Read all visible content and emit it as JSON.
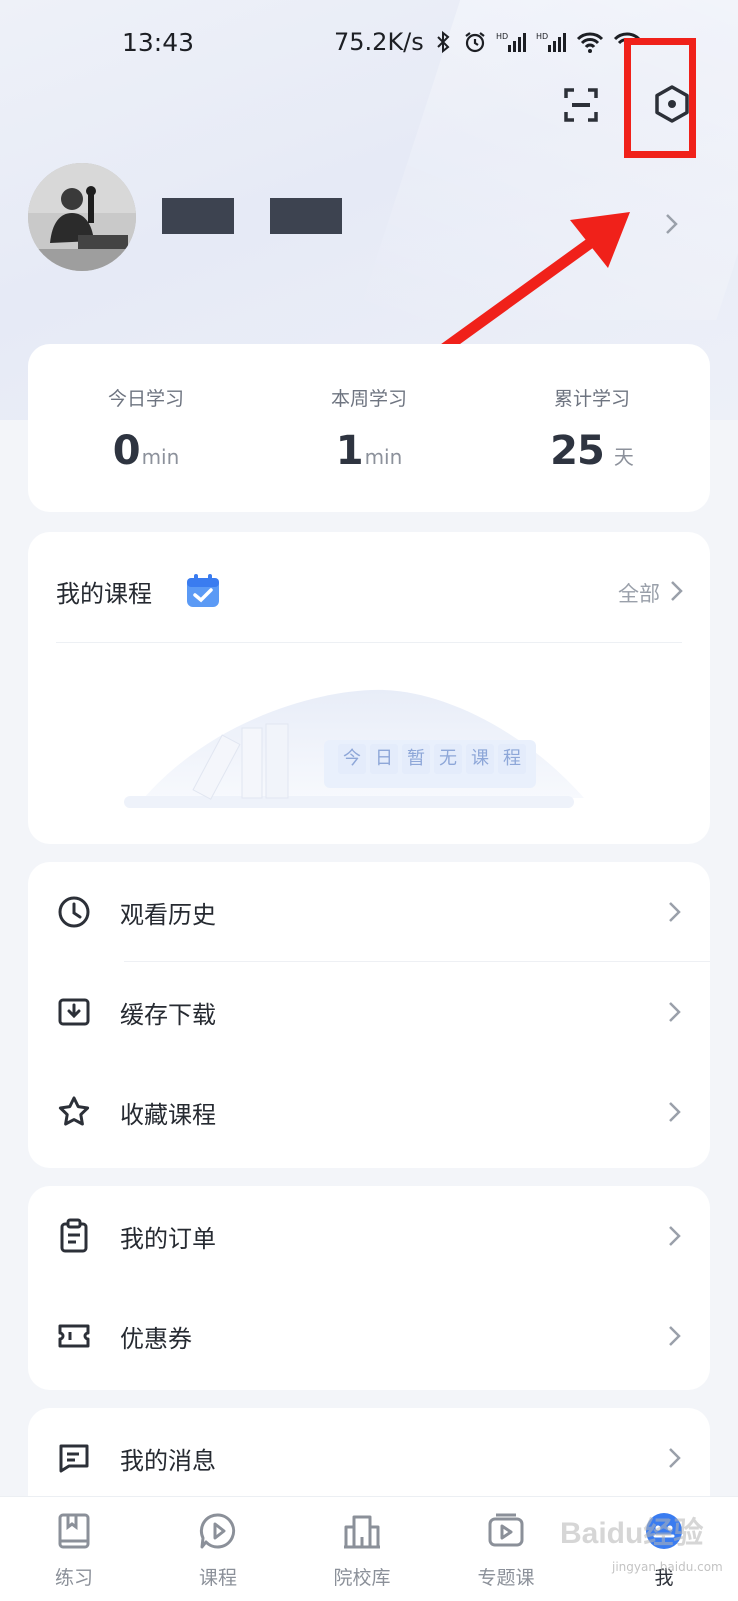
{
  "status_bar": {
    "time": "13:43",
    "speed": "75.2K/s"
  },
  "stats": [
    {
      "label": "今日学习",
      "value": "0",
      "unit": "min"
    },
    {
      "label": "本周学习",
      "value": "1",
      "unit": "min"
    },
    {
      "label": "累计学习",
      "value": "25",
      "unit": "天"
    }
  ],
  "my_courses": {
    "title": "我的课程",
    "all_label": "全部",
    "empty_chars": [
      "今",
      "日",
      "暂",
      "无",
      "课",
      "程"
    ]
  },
  "menu_group_1": [
    {
      "label": "观看历史",
      "icon": "clock-icon"
    },
    {
      "label": "缓存下载",
      "icon": "download-icon"
    },
    {
      "label": "收藏课程",
      "icon": "star-icon"
    }
  ],
  "menu_group_2": [
    {
      "label": "我的订单",
      "icon": "clipboard-icon"
    },
    {
      "label": "优惠券",
      "icon": "ticket-icon"
    }
  ],
  "menu_group_3": [
    {
      "label": "我的消息",
      "icon": "message-icon"
    }
  ],
  "bottom_nav": [
    {
      "label": "练习",
      "icon": "book-icon"
    },
    {
      "label": "课程",
      "icon": "play-chat-icon"
    },
    {
      "label": "院校库",
      "icon": "building-icon"
    },
    {
      "label": "专题课",
      "icon": "video-icon"
    },
    {
      "label": "我",
      "icon": "profile-face-icon",
      "active": true
    }
  ],
  "watermark": {
    "text": "Baidu经验",
    "sub": "jingyan.baidu.com"
  },
  "colors": {
    "accent": "#3a7cf0",
    "annotation": "#f0211a",
    "text_primary": "#262a31",
    "text_secondary": "#8b9099"
  }
}
